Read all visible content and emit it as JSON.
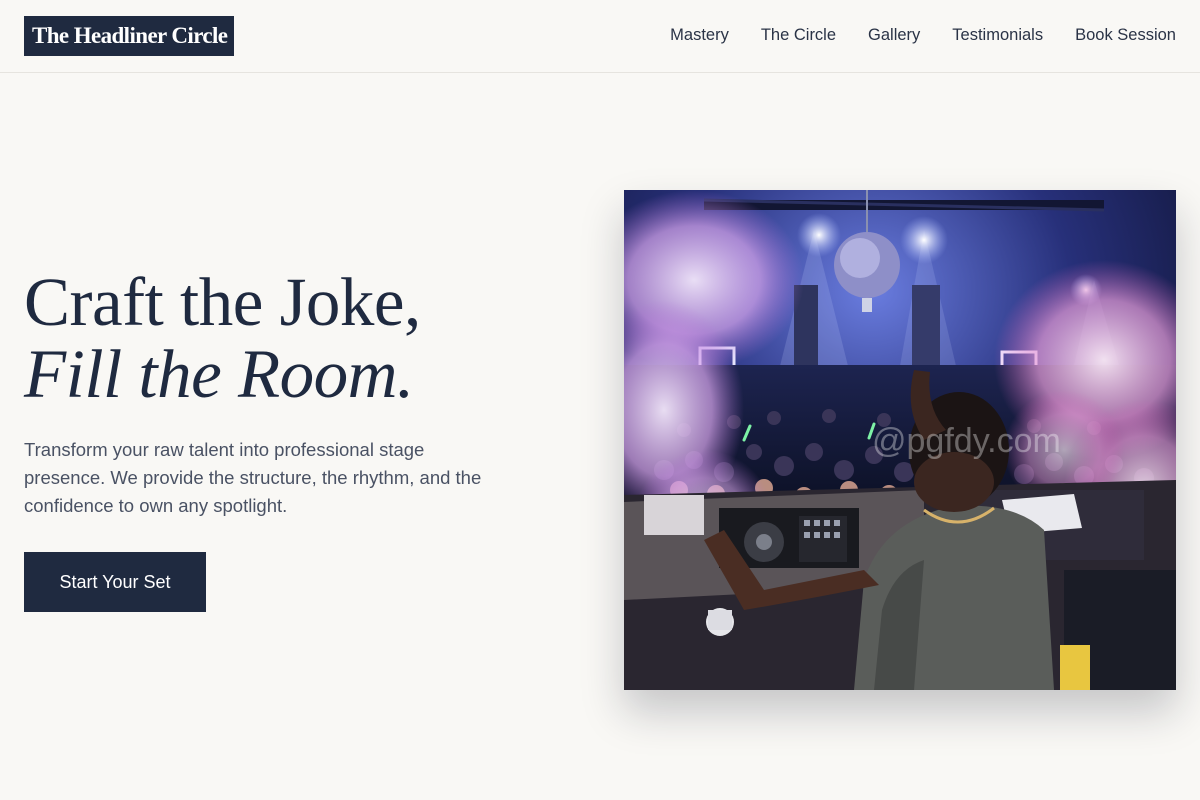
{
  "header": {
    "logo": "The Headliner Circle",
    "nav": [
      {
        "label": "Mastery"
      },
      {
        "label": "The Circle"
      },
      {
        "label": "Gallery"
      },
      {
        "label": "Testimonials"
      },
      {
        "label": "Book Session"
      }
    ]
  },
  "hero": {
    "title_line1": "Craft the Joke,",
    "title_line2": "Fill the Room.",
    "description": "Transform your raw talent into professional stage presence. We provide the structure, the rhythm, and the confidence to own any spotlight.",
    "cta_label": "Start Your Set"
  },
  "image": {
    "alt": "DJ performing at a crowded club with fog and lights",
    "watermark": "@pgfdy.com"
  },
  "colors": {
    "navy": "#1f2a40",
    "background": "#f9f8f5"
  }
}
